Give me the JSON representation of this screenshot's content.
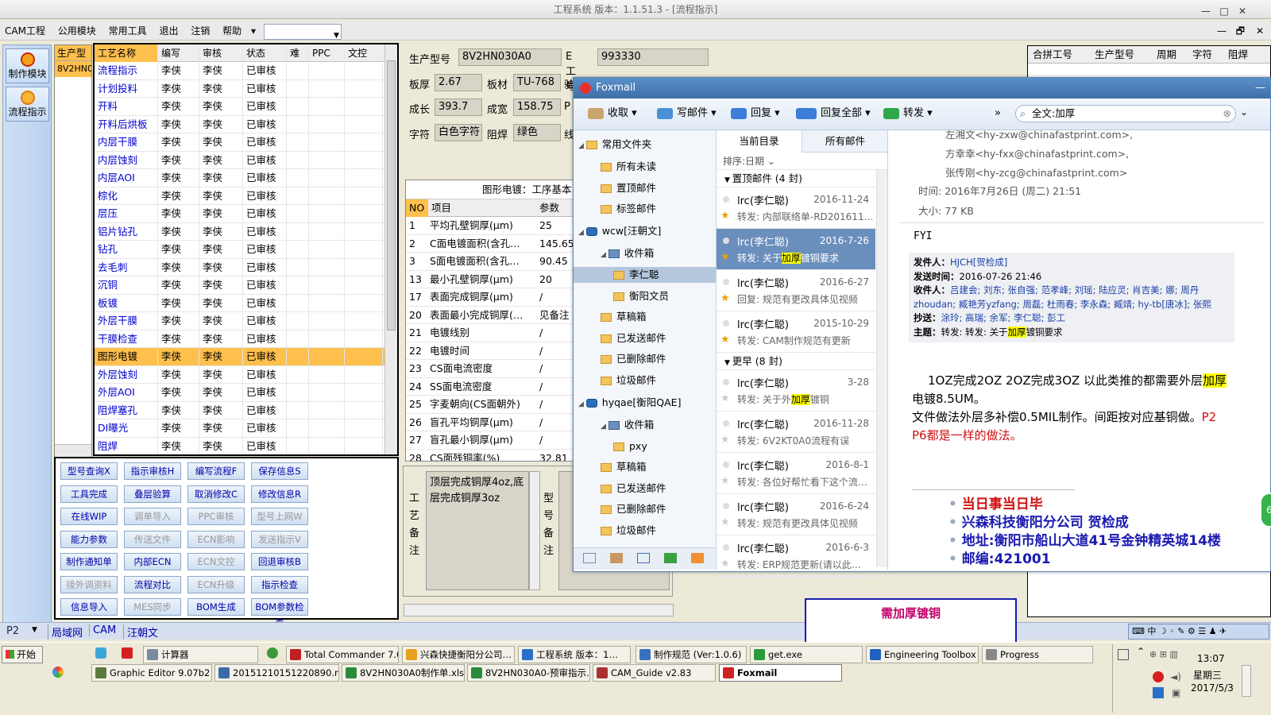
{
  "window": {
    "title": "工程系统   版本：1.1.51.3 - [流程指示]",
    "min": "—",
    "max": "□",
    "close": "✕"
  },
  "menu": [
    "CAM工程",
    "公用模块",
    "常用工具",
    "退出",
    "注销",
    "帮助"
  ],
  "menu_arrow": "▾",
  "mdi_controls": {
    "min": "—",
    "restore": "🗗",
    "close": "✕"
  },
  "modules": [
    {
      "label": "制作模块"
    },
    {
      "label": "流程指示"
    }
  ],
  "orders": {
    "header": "生产型",
    "value": "8V2HN0"
  },
  "process_grid": {
    "headers": [
      "工艺名称",
      "编写",
      "审核",
      "状态",
      "难",
      "PPC",
      "文控"
    ],
    "rows": [
      [
        "流程指示",
        "李侠",
        "李侠",
        "已审核"
      ],
      [
        "计划投料",
        "李侠",
        "李侠",
        "已审核"
      ],
      [
        "开料",
        "李侠",
        "李侠",
        "已审核"
      ],
      [
        "开料后烘板",
        "李侠",
        "李侠",
        "已审核"
      ],
      [
        "内层干膜",
        "李侠",
        "李侠",
        "已审核"
      ],
      [
        "内层蚀刻",
        "李侠",
        "李侠",
        "已审核"
      ],
      [
        "内层AOI",
        "李侠",
        "李侠",
        "已审核"
      ],
      [
        "棕化",
        "李侠",
        "李侠",
        "已审核"
      ],
      [
        "层压",
        "李侠",
        "李侠",
        "已审核"
      ],
      [
        "铝片钻孔",
        "李侠",
        "李侠",
        "已审核"
      ],
      [
        "钻孔",
        "李侠",
        "李侠",
        "已审核"
      ],
      [
        "去毛刺",
        "李侠",
        "李侠",
        "已审核"
      ],
      [
        "沉铜",
        "李侠",
        "李侠",
        "已审核"
      ],
      [
        "板镀",
        "李侠",
        "李侠",
        "已审核"
      ],
      [
        "外层干膜",
        "李侠",
        "李侠",
        "已审核"
      ],
      [
        "干膜检查",
        "李侠",
        "李侠",
        "已审核"
      ],
      [
        "图形电镀",
        "李侠",
        "李侠",
        "已审核"
      ],
      [
        "外层蚀刻",
        "李侠",
        "李侠",
        "已审核"
      ],
      [
        "外层AOI",
        "李侠",
        "李侠",
        "已审核"
      ],
      [
        "阻焊塞孔",
        "李侠",
        "李侠",
        "已审核"
      ],
      [
        "DI曝光",
        "李侠",
        "李侠",
        "已审核"
      ],
      [
        "阻焊",
        "李侠",
        "李侠",
        "已审核"
      ]
    ],
    "selected_index": 16
  },
  "buttons": [
    [
      {
        "label": "型号查询X",
        "enabled": true
      },
      {
        "label": "指示审核H",
        "enabled": true
      },
      {
        "label": "编写流程F",
        "enabled": true
      },
      {
        "label": "保存信息S",
        "enabled": true
      }
    ],
    [
      {
        "label": "工具完成",
        "enabled": true
      },
      {
        "label": "叠层验算",
        "enabled": true
      },
      {
        "label": "取消修改C",
        "enabled": true
      },
      {
        "label": "修改信息R",
        "enabled": true
      }
    ],
    [
      {
        "label": "在线WIP",
        "enabled": true
      },
      {
        "label": "调单导入",
        "enabled": false
      },
      {
        "label": "PPC审核",
        "enabled": false
      },
      {
        "label": "型号上网W",
        "enabled": false
      }
    ],
    [
      {
        "label": "能力参数",
        "enabled": true
      },
      {
        "label": "传送文件",
        "enabled": false
      },
      {
        "label": "ECN影响",
        "enabled": false
      },
      {
        "label": "发送指示V",
        "enabled": false
      }
    ],
    [
      {
        "label": "制作通知单",
        "enabled": true
      },
      {
        "label": "内部ECN",
        "enabled": true
      },
      {
        "label": "ECN文控",
        "enabled": false
      },
      {
        "label": "回退审核B",
        "enabled": true
      }
    ],
    [
      {
        "label": "接外调资料",
        "enabled": false
      },
      {
        "label": "流程对比",
        "enabled": true
      },
      {
        "label": "ECN升级",
        "enabled": false
      },
      {
        "label": "指示检查",
        "enabled": true
      }
    ],
    [
      {
        "label": "信息导入",
        "enabled": true
      },
      {
        "label": "MES同步",
        "enabled": false
      },
      {
        "label": "BOM生成",
        "enabled": true
      },
      {
        "label": "BOM参数检查",
        "enabled": true
      }
    ]
  ],
  "product_info": {
    "model_label": "生产型号",
    "model": "8V2HN030A0",
    "e_label": "E工号",
    "e_no": "993330",
    "thick_label": "板厚",
    "thick": "2.67",
    "material_label": "板材",
    "material": "TU-768",
    "extra_label_1": "验",
    "length_label": "成长",
    "length": "393.7",
    "width_label": "成宽",
    "width": "158.75",
    "extra_label_2": "P",
    "char_label": "字符",
    "char": "白色字符",
    "mask_label": "阻焊",
    "mask": "绿色",
    "extra_label_3": "线"
  },
  "params": {
    "title": "图形电镀：工序基本",
    "headers": [
      "NO",
      "项目",
      "参数"
    ],
    "rows": [
      [
        "1",
        "平均孔壁铜厚(μm)",
        "25"
      ],
      [
        "2",
        "C面电镀面积(含孔…",
        "145.65"
      ],
      [
        "3",
        "S面电镀面积(含孔…",
        "90.45"
      ],
      [
        "13",
        "最小孔壁铜厚(μm)",
        "20"
      ],
      [
        "17",
        "表面完成铜厚(μm)",
        "/"
      ],
      [
        "20",
        "表面最小完成铜厚(…",
        "见备注"
      ],
      [
        "21",
        "电镀线别",
        "/"
      ],
      [
        "22",
        "电镀时间",
        "/"
      ],
      [
        "23",
        "CS面电流密度",
        "/"
      ],
      [
        "24",
        "SS面电流密度",
        "/"
      ],
      [
        "25",
        "字麦朝向(CS面朝外)",
        "/"
      ],
      [
        "26",
        "盲孔平均铜厚(μm)",
        "/"
      ],
      [
        "27",
        "盲孔最小铜厚(μm)",
        "/"
      ],
      [
        "28",
        "CS面残铜率(%)",
        "32.81"
      ]
    ]
  },
  "remark": {
    "label": "工艺备注",
    "text": "顶层完成铜厚4oz,底层完成铜厚3oz",
    "label2": "型号备注"
  },
  "right_grid": {
    "headers": [
      "合拼工号",
      "生产型号",
      "周期",
      "字符",
      "阻焊"
    ]
  },
  "popup_note": {
    "text": "需加厚镀铜"
  },
  "status_tabs": {
    "p2": "P2",
    "tabs": [
      "局域网",
      "CAM",
      "汪朝文"
    ]
  },
  "foxmail": {
    "title": "Foxmail",
    "toolbar": {
      "receive": "收取",
      "compose": "写邮件",
      "reply": "回复",
      "reply_all": "回复全部",
      "forward": "转发",
      "more": "»",
      "search": "全文:加厚"
    },
    "folders": [
      {
        "label": "常用文件夹",
        "level": 0,
        "type": "group"
      },
      {
        "label": "所有未读",
        "level": 1
      },
      {
        "label": "置顶邮件",
        "level": 1
      },
      {
        "label": "标签邮件",
        "level": 1
      },
      {
        "label": "wcw[汪朝文]",
        "level": 0,
        "type": "account"
      },
      {
        "label": "收件箱",
        "level": 1,
        "type": "inbox"
      },
      {
        "label": "李仁聪",
        "level": 2,
        "selected": true
      },
      {
        "label": "衡阳文员",
        "level": 2
      },
      {
        "label": "草稿箱",
        "level": 1
      },
      {
        "label": "已发送邮件",
        "level": 1
      },
      {
        "label": "已删除邮件",
        "level": 1
      },
      {
        "label": "垃圾邮件",
        "level": 1
      },
      {
        "label": "hyqae[衡阳QAE]",
        "level": 0,
        "type": "account"
      },
      {
        "label": "收件箱",
        "level": 1,
        "type": "inbox"
      },
      {
        "label": "pxy",
        "level": 2
      },
      {
        "label": "草稿箱",
        "level": 1
      },
      {
        "label": "已发送邮件",
        "level": 1
      },
      {
        "label": "已删除邮件",
        "level": 1
      },
      {
        "label": "垃圾邮件",
        "level": 1
      }
    ],
    "list_tabs": [
      "当前目录",
      "所有邮件"
    ],
    "sort": "排序:日期",
    "group_pinned": "置顶邮件 (4 封)",
    "group_earlier": "更早 (8 封)",
    "mails_pinned": [
      {
        "from": "lrc(李仁聪)",
        "date": "2016-11-24",
        "subject_pre": "转发: 内部联络单-RD201611…",
        "hl": "",
        "subject_post": "",
        "selected": false
      },
      {
        "from": "lrc(李仁聪)",
        "date": "2016-7-26",
        "subject_pre": "转发: 关于",
        "hl": "加厚",
        "subject_post": "镀铜要求",
        "selected": true
      },
      {
        "from": "lrc(李仁聪)",
        "date": "2016-6-27",
        "subject_pre": "回复: 规范有更改具体见视频",
        "hl": "",
        "subject_post": "",
        "selected": false
      },
      {
        "from": "lrc(李仁聪)",
        "date": "2015-10-29",
        "subject_pre": "转发: CAM制作规范有更新",
        "hl": "",
        "subject_post": "",
        "selected": false
      }
    ],
    "mails_earlier": [
      {
        "from": "lrc(李仁聪)",
        "date": "3-28",
        "subject_pre": "转发: 关于外",
        "hl": "加厚",
        "subject_post": "镀铜"
      },
      {
        "from": "lrc(李仁聪)",
        "date": "2016-11-28",
        "subject_pre": "转发: 6V2KT0A0流程有误",
        "hl": "",
        "subject_post": ""
      },
      {
        "from": "lrc(李仁聪)",
        "date": "2016-8-1",
        "subject_pre": "转发: 各位好帮忙看下这个流…",
        "hl": "",
        "subject_post": ""
      },
      {
        "from": "lrc(李仁聪)",
        "date": "2016-6-24",
        "subject_pre": "转发: 规范有更改具体见视频",
        "hl": "",
        "subject_post": ""
      },
      {
        "from": "lrc(李仁聪)",
        "date": "2016-6-3",
        "subject_pre": "转发: ERP规范更新(请以此…",
        "hl": "",
        "subject_post": ""
      }
    ],
    "reading": {
      "cc_lines": [
        "左湘文<hy-zxw@chinafastprint.com>,",
        "方幸幸<hy-fxx@chinafastprint.com>,",
        "张传刚<hy-zcg@chinafastprint.com>"
      ],
      "time_label": "时间:",
      "time": "2016年7月26日 (周二) 21:51",
      "size_label": "大小:",
      "size": "77 KB",
      "fyi": "FYI",
      "fwd_from_label": "发件人：",
      "fwd_from": "HJCH[贺检成]",
      "fwd_time_label": "发送时间：",
      "fwd_time": "2016-07-26 21:46",
      "fwd_to_label": "收件人：",
      "fwd_to": "吕建会; 刘东; 张自强; 范孝峰; 刘瑶; 陆应灵; 肖吉美; 娜; 周丹zhoudan; 臧艳芳yzfang; 周磊; 杜雨春; 李永森; 臧靖; hy-tb[唐冰]; 张熙",
      "fwd_cc_label": "抄送：",
      "fwd_cc": "涂玲; 高瑞; 余军; 李仁聪; 彭工",
      "fwd_subj_label": "主题：",
      "fwd_subj_pre": "转发: 转发: 关于",
      "fwd_subj_hl": "加厚",
      "fwd_subj_post": "镀铜要求",
      "body1_pre": "1OZ完成2OZ 2OZ完成3OZ 以此类推的都需要外层",
      "body1_hl": "加厚",
      "body1_post": "电镀8.5UM。",
      "body2": "文件做法外层多补偿0.5MIL制作。间距按对应基铜做。",
      "body2_red": "P2 P6都是一样的做法。",
      "sig": [
        "当日事当日毕",
        "兴森科技衡阳分公司   贺检成",
        "地址:衡阳市船山大道41号金钟精英城14楼",
        "邮编:421001"
      ]
    }
  },
  "taskbar": {
    "start": "开始",
    "row1": [
      "计算器",
      "Total Commander 7.0 …",
      "兴森快捷衡阳分公司…",
      "工程系统   版本：1…",
      "制作规范 (Ver:1.0.6)",
      "get.exe",
      "Engineering Toolbox …",
      "Progress"
    ],
    "row2": [
      "Graphic Editor 9.07b2 (0…",
      "20151210151220890.rtf…",
      "8V2HN030A0制作单.xls …",
      "8V2HN030A0-预审指示…",
      "CAM_Guide v2.83",
      "Foxmail"
    ],
    "clock": "13:07",
    "weekday": "星期三",
    "date": "2017/5/3",
    "ime": "中"
  },
  "colors": {
    "selected_row": "#ffc04d",
    "accent": "#3d6fa9",
    "link_blue": "#0000cc",
    "popup_text": "#c0006b"
  }
}
